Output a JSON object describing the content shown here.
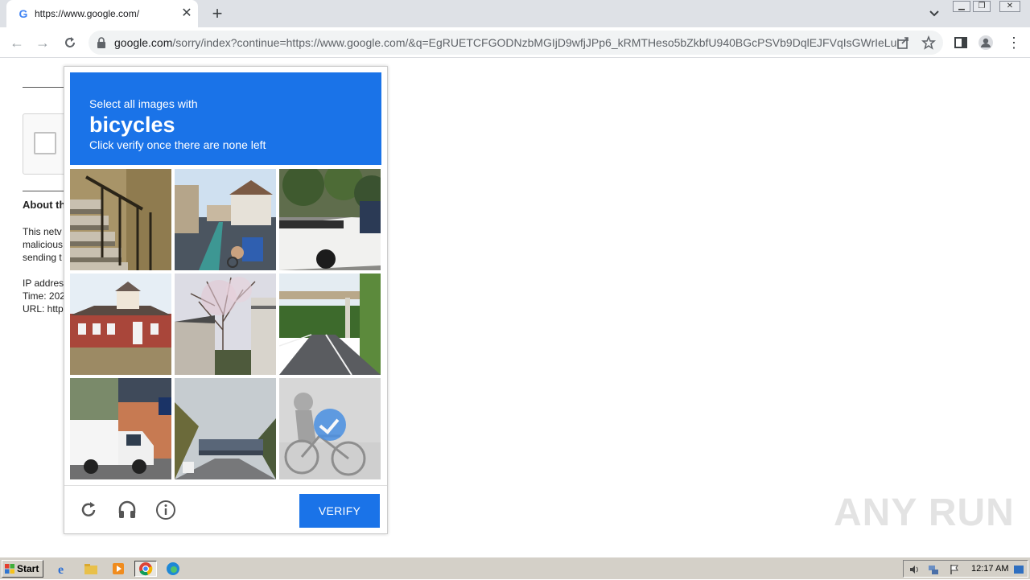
{
  "browser": {
    "tab_title": "https://www.google.com/",
    "url_host": "google.com",
    "url_path": "/sorry/index?continue=https://www.google.com/&q=EgRUETCFGODNzbMGIjD9wfjJPp6_kRMTHeso5bZkbfU940BGcPSVb9DqlEJFVqIsGWrIeLui..."
  },
  "background_page": {
    "heading": "About th",
    "lines": [
      "This netv",
      "malicious",
      "sending t"
    ],
    "info_lines": [
      "IP addres",
      "Time: 202",
      "URL: http"
    ]
  },
  "captcha": {
    "prompt_small": "Select all images with",
    "prompt_target": "bicycles",
    "prompt_instruction": "Click verify once there are none left",
    "verify_label": "VERIFY",
    "tiles": [
      {
        "subject": "stairs-with-railing",
        "selected": false
      },
      {
        "subject": "residential-street-with-cyclist",
        "selected": false
      },
      {
        "subject": "white-pickup-truck",
        "selected": false
      },
      {
        "subject": "red-house",
        "selected": false
      },
      {
        "subject": "houses-with-bare-tree",
        "selected": false
      },
      {
        "subject": "road-under-overpass",
        "selected": false
      },
      {
        "subject": "white-delivery-truck",
        "selected": false
      },
      {
        "subject": "bridge-over-road",
        "selected": false
      },
      {
        "subject": "person-on-bicycle",
        "selected": true
      }
    ],
    "accent_color": "#1a73e8"
  },
  "watermark": "ANY RUN",
  "taskbar": {
    "start_label": "Start",
    "clock": "12:17 AM"
  }
}
